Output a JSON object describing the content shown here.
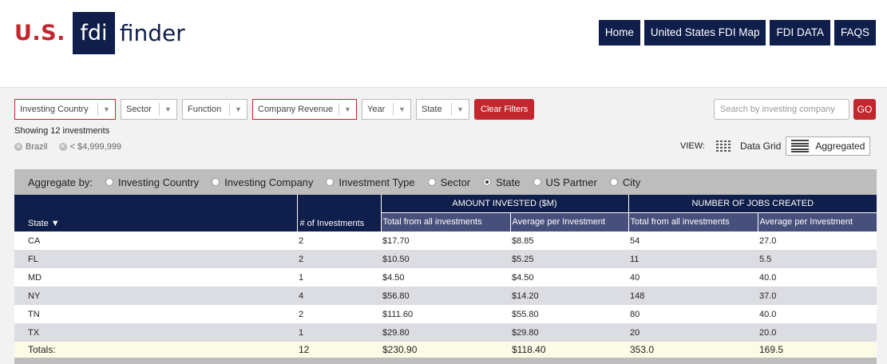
{
  "logo": {
    "us": "U.S.",
    "fdi": "fdi",
    "finder": "finder"
  },
  "nav": [
    "Home",
    "United States FDI Map",
    "FDI DATA",
    "FAQS"
  ],
  "filters": [
    {
      "label": "Investing Country",
      "active": true
    },
    {
      "label": "Sector",
      "active": false
    },
    {
      "label": "Function",
      "active": false
    },
    {
      "label": "Company Revenue",
      "active": true
    },
    {
      "label": "Year",
      "active": false
    },
    {
      "label": "State",
      "active": false
    }
  ],
  "clear_filters": "Clear Filters",
  "search": {
    "placeholder": "Search by investing company",
    "go": "GO"
  },
  "showing": "Showing 12 investments",
  "chips": [
    "Brazil",
    "< $4,999,999"
  ],
  "view": {
    "label": "VIEW:",
    "options": [
      "Data Grid",
      "Aggregated"
    ],
    "selected": "Aggregated"
  },
  "aggregate": {
    "label": "Aggregate by:",
    "options": [
      "Investing Country",
      "Investing Company",
      "Investment Type",
      "Sector",
      "State",
      "US Partner",
      "City"
    ],
    "selected": "State"
  },
  "table": {
    "state_header": "State ▼",
    "count_header": "# of Investments",
    "group_amount": "AMOUNT INVESTED ($M)",
    "group_jobs": "NUMBER OF JOBS CREATED",
    "sub_total": "Total from all investments",
    "sub_avg": "Average per Investment",
    "rows": [
      [
        "CA",
        "2",
        "$17.70",
        "$8.85",
        "54",
        "27.0"
      ],
      [
        "FL",
        "2",
        "$10.50",
        "$5.25",
        "11",
        "5.5"
      ],
      [
        "MD",
        "1",
        "$4.50",
        "$4.50",
        "40",
        "40.0"
      ],
      [
        "NY",
        "4",
        "$56.80",
        "$14.20",
        "148",
        "37.0"
      ],
      [
        "TN",
        "2",
        "$111.60",
        "$55.80",
        "80",
        "40.0"
      ],
      [
        "TX",
        "1",
        "$29.80",
        "$29.80",
        "20",
        "20.0"
      ]
    ],
    "totals": [
      "Totals:",
      "12",
      "$230.90",
      "$118.40",
      "353.0",
      "169.5"
    ]
  }
}
